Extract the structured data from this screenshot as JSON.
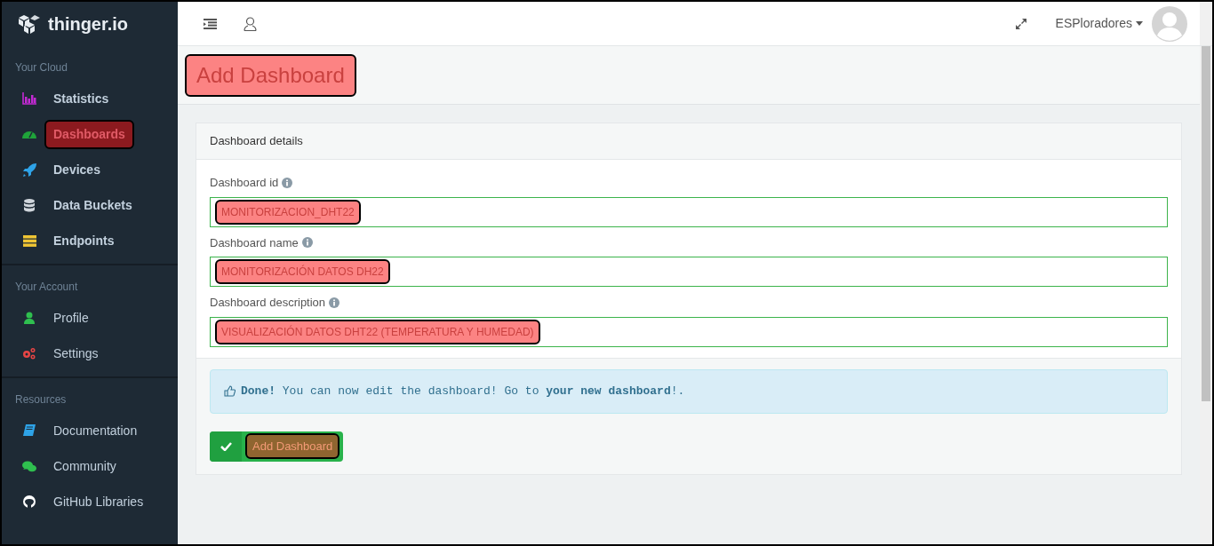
{
  "brand": "thinger.io",
  "sidebar": [
    {
      "heading": "Your Cloud",
      "items": [
        {
          "label": "Statistics",
          "highlighted": false
        },
        {
          "label": "Dashboards",
          "highlighted": true
        },
        {
          "label": "Devices",
          "highlighted": false
        },
        {
          "label": "Data Buckets",
          "highlighted": false
        },
        {
          "label": "Endpoints",
          "highlighted": false
        }
      ]
    },
    {
      "heading": "Your Account",
      "items": [
        {
          "label": "Profile",
          "highlighted": false
        },
        {
          "label": "Settings",
          "highlighted": false
        }
      ]
    },
    {
      "heading": "Resources",
      "items": [
        {
          "label": "Documentation",
          "highlighted": false
        },
        {
          "label": "Community",
          "highlighted": false
        },
        {
          "label": "GitHub Libraries",
          "highlighted": false
        }
      ]
    }
  ],
  "topbar": {
    "user": "ESPloradores"
  },
  "page_title": {
    "text": "Add Dashboard",
    "highlighted": true
  },
  "card": {
    "title": "Dashboard details",
    "fields": [
      {
        "label": "Dashboard id",
        "value": "MONITORIZACION_DHT22",
        "highlighted": true
      },
      {
        "label": "Dashboard name",
        "value": "MONITORIZACIÓN DATOS DH22",
        "highlighted": true
      },
      {
        "label": "Dashboard description",
        "value": "VISUALIZACIÓN DATOS DHT22 (TEMPERATURA Y HUMEDAD)",
        "highlighted": true
      }
    ],
    "alert": "**Done!** You can now edit the dashboard! Go to **your new dashboard**!.",
    "submit": {
      "label": "Add Dashboard",
      "highlighted": true
    }
  }
}
